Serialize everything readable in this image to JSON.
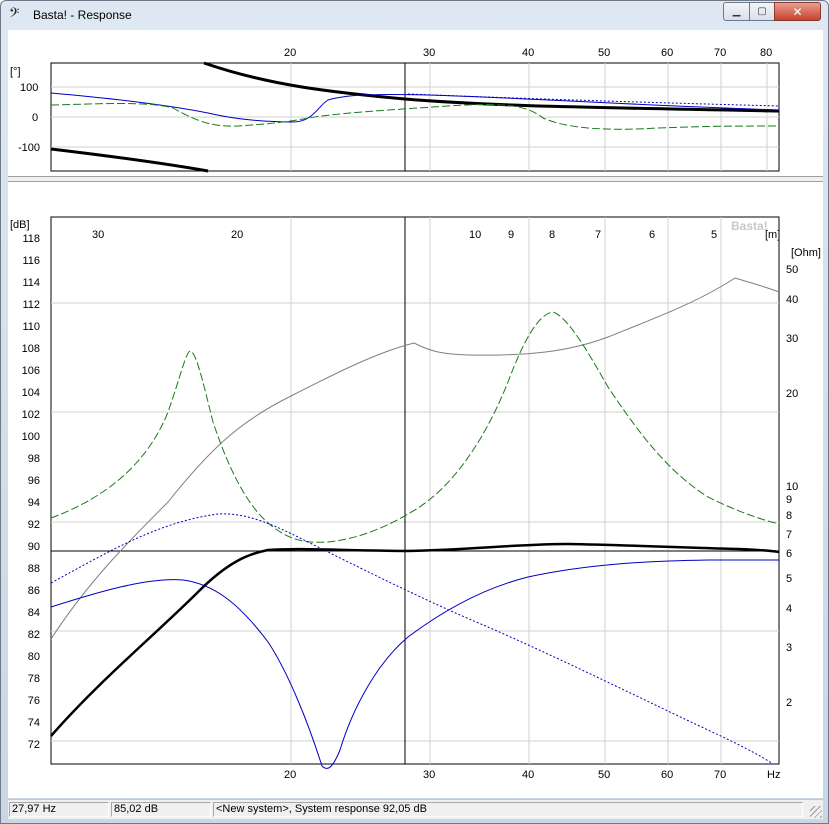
{
  "window": {
    "title": "Basta! - Response",
    "app_icon": "bass-clef-icon",
    "buttons": {
      "minimize": "minimize-icon",
      "maximize": "maximize-icon",
      "close": "close-icon"
    }
  },
  "phase_plot": {
    "y_unit": "[°]",
    "y_ticks": [
      "100",
      "0",
      "-100"
    ],
    "x_top_ticks": [
      "20",
      "30",
      "40",
      "50",
      "60",
      "70",
      "80"
    ]
  },
  "main_plot": {
    "watermark": "Basta!",
    "y_unit_left": "[dB]",
    "y_ticks_left": [
      "118",
      "116",
      "114",
      "112",
      "110",
      "108",
      "106",
      "104",
      "102",
      "100",
      "98",
      "96",
      "94",
      "92",
      "90",
      "88",
      "86",
      "84",
      "82",
      "80",
      "78",
      "76",
      "74",
      "72"
    ],
    "y_unit_right": "[Ohm]",
    "y_ticks_right": [
      "50",
      "40",
      "30",
      "20",
      "10",
      "9",
      "8",
      "7",
      "6",
      "5",
      "4",
      "3",
      "2"
    ],
    "x_top_unit": "[m]",
    "x_top_ticks": [
      "30",
      "20",
      "10",
      "9",
      "8",
      "7",
      "6",
      "5"
    ],
    "x_bottom_ticks": [
      "20",
      "30",
      "40",
      "50",
      "60",
      "70"
    ],
    "x_bottom_unit": "Hz"
  },
  "status": {
    "frequency": "27,97 Hz",
    "level": "85,02 dB",
    "system": "<New system>, System response 92,05 dB"
  },
  "colors": {
    "system_response": "#000000",
    "impedance": "#808080",
    "driver_response": "#0000c0",
    "dashed_response": "#1a7a1a"
  }
}
